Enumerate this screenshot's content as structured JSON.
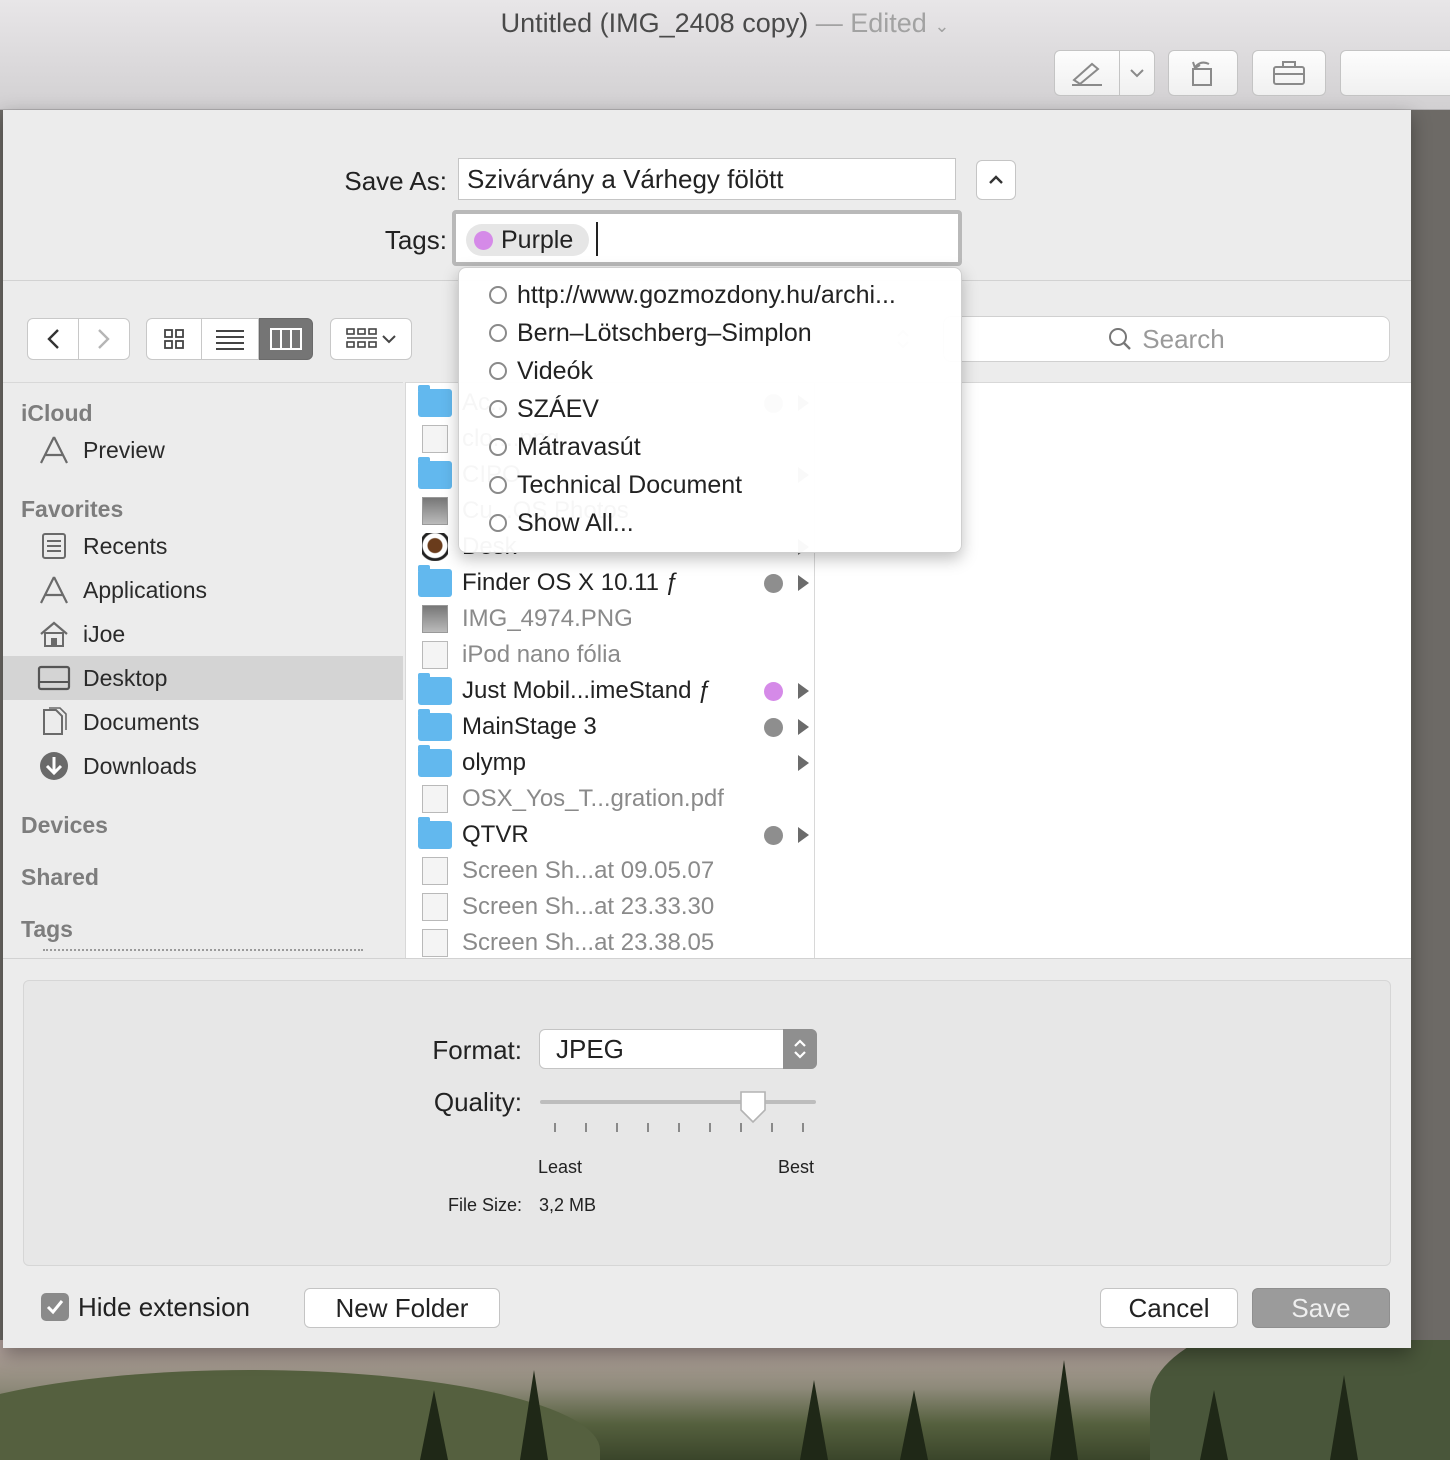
{
  "window": {
    "title": "Untitled (IMG_2408 copy)",
    "title_sep": " — ",
    "edited": "Edited"
  },
  "save_dialog": {
    "save_as_label": "Save As:",
    "save_as_value": "Szivárvány a Várhegy fölött",
    "tags_label": "Tags:",
    "current_tag": {
      "name": "Purple",
      "color": "#d58ae8"
    },
    "tag_suggestions": [
      "http://www.gozmozdony.hu/archi...",
      "Bern–Lötschberg–Simplon",
      "Videók",
      "SZÁEV",
      "Mátravasút",
      "Technical Document",
      "Show All..."
    ],
    "search_placeholder": "Search"
  },
  "sidebar": {
    "icloud_header": "iCloud",
    "icloud_items": [
      "Preview"
    ],
    "favorites_header": "Favorites",
    "favorites": [
      {
        "label": "Recents",
        "icon": "recents-icon"
      },
      {
        "label": "Applications",
        "icon": "applications-icon"
      },
      {
        "label": "iJoe",
        "icon": "home-icon"
      },
      {
        "label": "Desktop",
        "icon": "desktop-icon",
        "selected": true
      },
      {
        "label": "Documents",
        "icon": "documents-icon"
      },
      {
        "label": "Downloads",
        "icon": "downloads-icon"
      }
    ],
    "devices_header": "Devices",
    "shared_header": "Shared",
    "tags_header": "Tags"
  },
  "files": [
    {
      "name": "Ac...",
      "kind": "folder",
      "tag": "#a0a0a0",
      "arrow": true,
      "hidden_by_popup": true
    },
    {
      "name": "clo....png",
      "kind": "doc",
      "hidden_by_popup": true
    },
    {
      "name": "CIPO",
      "kind": "folder",
      "arrow": true,
      "hidden_by_popup": true
    },
    {
      "name": "Cu...OS Photos",
      "kind": "thumb",
      "hidden_by_popup": true
    },
    {
      "name": "Desk",
      "kind": "mug",
      "arrow": true,
      "hidden_by_popup": true
    },
    {
      "name": "Finder OS X 10.11 ƒ",
      "kind": "folder",
      "tag": "#8e8e8e",
      "arrow": true
    },
    {
      "name": "IMG_4974.PNG",
      "kind": "thumb",
      "dim": true
    },
    {
      "name": "iPod nano fólia",
      "kind": "doc",
      "dim": true
    },
    {
      "name": "Just Mobil...imeStand ƒ",
      "kind": "folder",
      "tag": "#d58ae8",
      "arrow": true
    },
    {
      "name": "MainStage 3",
      "kind": "folder",
      "tag": "#8e8e8e",
      "arrow": true
    },
    {
      "name": "olymp",
      "kind": "folder",
      "arrow": true
    },
    {
      "name": "OSX_Yos_T...gration.pdf",
      "kind": "doc",
      "dim": true
    },
    {
      "name": "QTVR",
      "kind": "folder",
      "tag": "#8e8e8e",
      "arrow": true
    },
    {
      "name": "Screen Sh...at 09.05.07",
      "kind": "doc",
      "dim": true
    },
    {
      "name": "Screen Sh...at 23.33.30",
      "kind": "doc",
      "dim": true
    },
    {
      "name": "Screen Sh...at 23.38.05",
      "kind": "doc",
      "dim": true
    }
  ],
  "options": {
    "format_label": "Format:",
    "format_value": "JPEG",
    "quality_label": "Quality:",
    "quality_level": 0.77,
    "least_label": "Least",
    "best_label": "Best",
    "filesize_label": "File Size:",
    "filesize_value": "3,2 MB"
  },
  "footer": {
    "hide_extension_label": "Hide extension",
    "hide_extension_checked": true,
    "new_folder_label": "New Folder",
    "cancel_label": "Cancel",
    "save_label": "Save"
  }
}
